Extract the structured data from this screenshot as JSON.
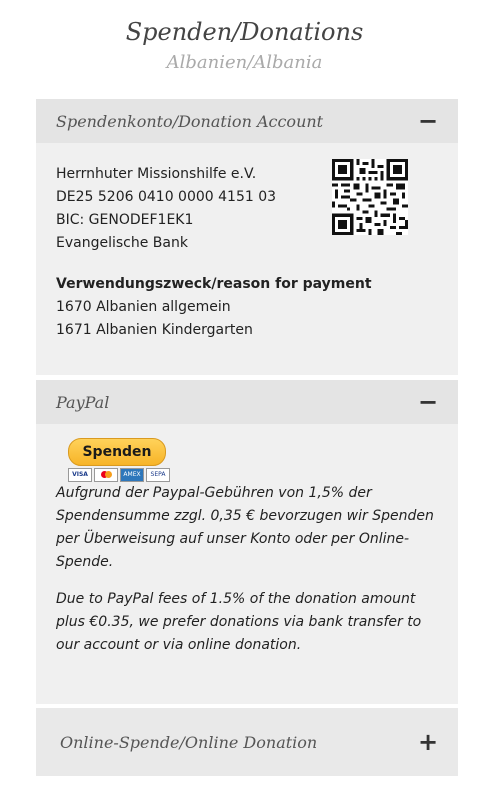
{
  "header": {
    "title": "Spenden/Donations",
    "subtitle": "Albanien/Albania"
  },
  "account_section": {
    "title": "Spendenkonto/Donation Account",
    "toggle": "−",
    "lines": [
      "Herrnhuter Missionshilfe e.V.",
      "DE25 5206 0410 0000 4151 03",
      "BIC: GENODEF1EK1",
      "Evangelische Bank"
    ],
    "purpose_heading": "Verwendungszweck/reason for payment",
    "purposes": [
      "1670 Albanien allgemein",
      "1671 Albanien Kindergarten"
    ],
    "qr_icon": "qr-code"
  },
  "paypal_section": {
    "title": "PayPal",
    "toggle": "−",
    "button_label": "Spenden",
    "payment_icons": [
      "visa",
      "mastercard",
      "amex",
      "sepa"
    ],
    "card_labels": [
      "VISA",
      "",
      "AMEX",
      "SEPA"
    ],
    "text_de": "Aufgrund der Paypal-Gebühren von 1,5% der Spendensumme zzgl. 0,35 € bevorzugen wir Spenden per Überweisung auf unser Konto oder per Online-Spende.",
    "text_en": "Due to PayPal fees of 1.5% of the donation amount plus €0.35, we prefer donations via bank transfer to our account or via online donation."
  },
  "online_section": {
    "title": "Online-Spende/Online Donation",
    "toggle": "+"
  }
}
